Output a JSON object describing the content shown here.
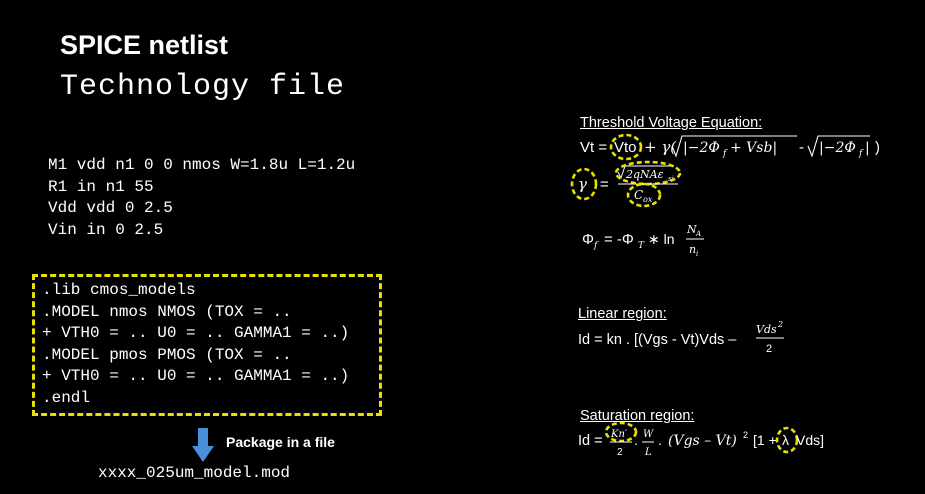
{
  "slide": {
    "title": "SPICE netlist",
    "subtitle": "Technology file",
    "netlist": [
      "M1 vdd n1 0 0 nmos W=1.8u L=1.2u",
      "R1 in n1 55",
      "Vdd vdd 0 2.5",
      "Vin in 0 2.5"
    ],
    "library": [
      ".lib cmos_models",
      ".MODEL nmos  NMOS (TOX = ..",
      "+ VTH0 = .. U0 = .. GAMMA1 = ..)",
      ".MODEL pmos  PMOS (TOX = ..",
      "+ VTH0 = .. U0 = .. GAMMA1 = ..)",
      ".endl"
    ],
    "package_label": "Package in a file",
    "model_file": "xxxx_025um_model.mod",
    "highlight_color": "#e8e000",
    "arrow_color": "#4a90d9"
  },
  "equations": {
    "threshold_header": "Threshold Voltage Equation:",
    "vt_prefix": "Vt =",
    "vto": "Vto",
    "plus_gamma": "+ γ(",
    "sqrt1": "|−2Φ",
    "sqrt1_sub": "f",
    "sqrt1_rest": " + Vsb|",
    "minus": "-",
    "sqrt2": "|−2Φ",
    "sqrt2_sub": "f",
    "sqrt2_rest": "|",
    "close_paren": ")",
    "gamma": "γ",
    "equals": "=",
    "gamma_num": "2qNAε",
    "gamma_num_sub": "si",
    "gamma_den": "C",
    "gamma_den_sub": "ox",
    "phi_f": "Φ",
    "phi_f_sub": "f",
    "phi_eq": "= -Φ",
    "phi_t_sub": "T",
    "phi_ln": "∗ ln",
    "phi_num": "N",
    "phi_num_sub": "A",
    "phi_den": "n",
    "phi_den_sub": "i",
    "linear_header": "Linear region:",
    "linear_eq": "Id = kn . [(Vgs - Vt)Vds –",
    "linear_frac_num": "Vds",
    "linear_frac_exp": "2",
    "linear_frac_den": "2",
    "saturation_header": "Saturation region:",
    "sat_id": "Id =",
    "sat_kn": "Kn′",
    "sat_two": "2",
    "sat_w": "W",
    "sat_l": "L",
    "sat_dot": ".",
    "sat_dot2": ".",
    "sat_vgs": "(Vgs – Vt)",
    "sat_exp": "2",
    "sat_bracket": "[1 +",
    "sat_lambda": "λ",
    "sat_vds": "Vds]"
  }
}
